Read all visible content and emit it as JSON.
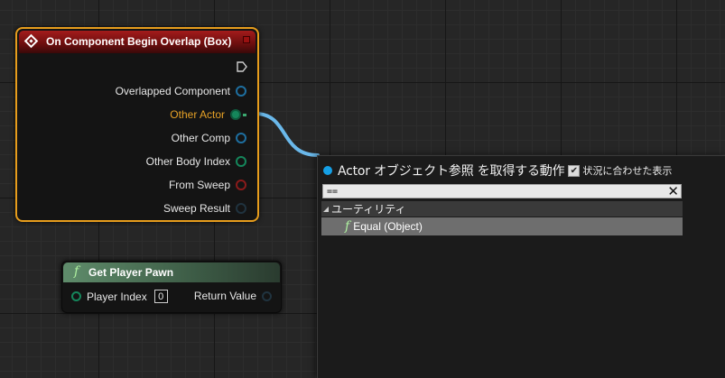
{
  "event_node": {
    "title": "On Component Begin Overlap (Box)",
    "pins": [
      {
        "label": "Overlapped Component",
        "icon": "object-pin-icon"
      },
      {
        "label": "Other Actor",
        "icon": "object-pin-icon"
      },
      {
        "label": "Other Comp",
        "icon": "object-pin-icon"
      },
      {
        "label": "Other Body Index",
        "icon": "integer-pin-icon"
      },
      {
        "label": "From Sweep",
        "icon": "boolean-pin-icon"
      },
      {
        "label": "Sweep Result",
        "icon": "struct-pin-icon"
      }
    ],
    "colors": {
      "border": "#e79d1c",
      "header": "#a31b1b",
      "highlight_label": "#e6a126"
    }
  },
  "func_node": {
    "icon": "function-icon",
    "title": "Get Player Pawn",
    "input_label": "Player Index",
    "input_value": "0",
    "output_label": "Return Value"
  },
  "action_menu": {
    "title": "Actor オブジェクト参照 を取得する動作",
    "context_checked": "✔",
    "context_label": "状況に合わせた表示",
    "search_value": "==",
    "clear_icon": "✕",
    "category": "ユーティリティ",
    "result_icon_glyph": "f",
    "result": "Equal (Object)",
    "colors": {
      "dot": "#15a0e6",
      "selected_row": "#6e6e6e"
    }
  },
  "wire": {
    "color": "#6ab8ea"
  }
}
